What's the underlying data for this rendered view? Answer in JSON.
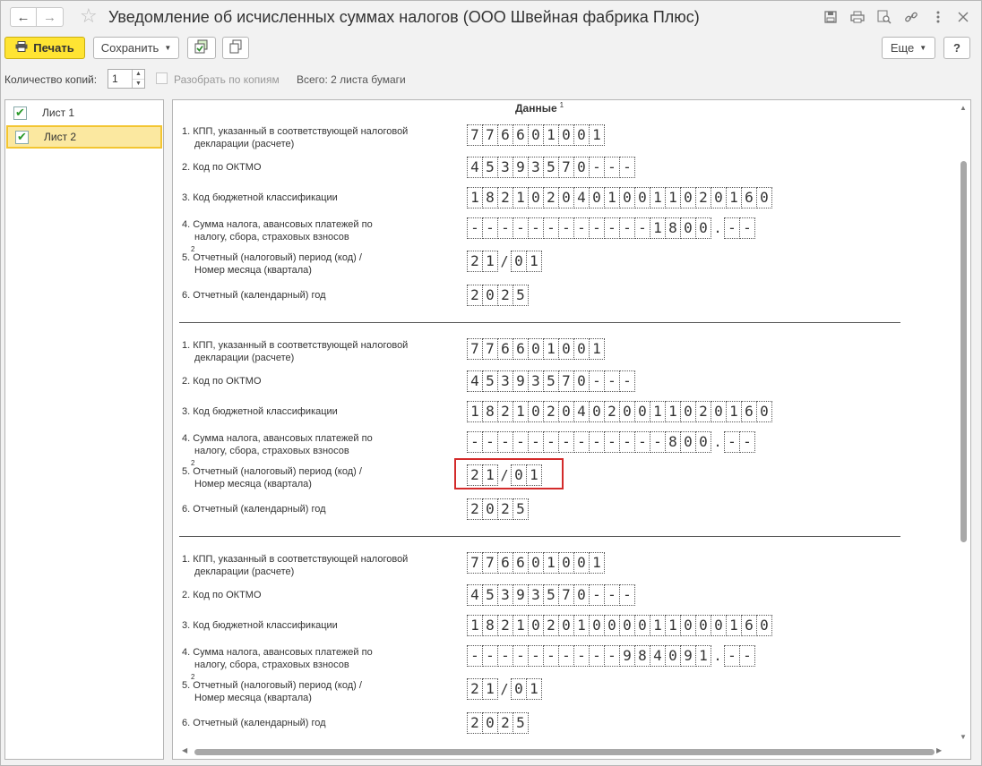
{
  "window": {
    "title": "Уведомление об исчисленных суммах налогов (ООО Швейная фабрика Плюс)",
    "back_icon": "←",
    "forward_icon": "→",
    "star_icon": "☆"
  },
  "toolbar": {
    "print_label": "Печать",
    "save_label": "Сохранить",
    "more_label": "Еще",
    "help_label": "?"
  },
  "copies": {
    "label": "Количество копий:",
    "value": "1",
    "collate_label": "Разобрать по копиям",
    "total_label": "Всего: 2 листа бумаги"
  },
  "sheets": [
    {
      "label": "Лист 1",
      "checked": true
    },
    {
      "label": "Лист 2",
      "checked": true,
      "selected": true
    }
  ],
  "document": {
    "header": "Данные",
    "header_sup": "1",
    "labels": {
      "kpp_1": "1. КПП, указанный в соответствующей налоговой",
      "kpp_2": "декларации (расчете)",
      "oktmo": "2. Код по ОКТМО",
      "kbk": "3. Код бюджетной классификации",
      "sum_1": "4. Сумма налога, авансовых платежей по",
      "sum_2": "налогу, сбора, страховых взносов",
      "sum_sup": "2",
      "period_1": "5. Отчетный (налоговый) период (код) /",
      "period_2": "Номер месяца (квартала)",
      "year": "6. Отчетный (календарный) год"
    },
    "blocks": [
      {
        "kpp": [
          "7",
          "7",
          "6",
          "6",
          "0",
          "1",
          "0",
          "0",
          "1"
        ],
        "oktmo": [
          "4",
          "5",
          "3",
          "9",
          "3",
          "5",
          "7",
          "0",
          "-",
          "-",
          "-"
        ],
        "kbk": [
          "1",
          "8",
          "2",
          "1",
          "0",
          "2",
          "0",
          "4",
          "0",
          "1",
          "0",
          "0",
          "1",
          "1",
          "0",
          "2",
          "0",
          "1",
          "6",
          "0"
        ],
        "sum_int": [
          "-",
          "-",
          "-",
          "-",
          "-",
          "-",
          "-",
          "-",
          "-",
          "-",
          "-",
          "-",
          "1",
          "8",
          "0",
          "0"
        ],
        "sum_frac": [
          "-",
          "-"
        ],
        "period_code": [
          "2",
          "1"
        ],
        "period_month": [
          "0",
          "1"
        ],
        "year": [
          "2",
          "0",
          "2",
          "5"
        ]
      },
      {
        "kpp": [
          "7",
          "7",
          "6",
          "6",
          "0",
          "1",
          "0",
          "0",
          "1"
        ],
        "oktmo": [
          "4",
          "5",
          "3",
          "9",
          "3",
          "5",
          "7",
          "0",
          "-",
          "-",
          "-"
        ],
        "kbk": [
          "1",
          "8",
          "2",
          "1",
          "0",
          "2",
          "0",
          "4",
          "0",
          "2",
          "0",
          "0",
          "1",
          "1",
          "0",
          "2",
          "0",
          "1",
          "6",
          "0"
        ],
        "sum_int": [
          "-",
          "-",
          "-",
          "-",
          "-",
          "-",
          "-",
          "-",
          "-",
          "-",
          "-",
          "-",
          "-",
          "8",
          "0",
          "0"
        ],
        "sum_frac": [
          "-",
          "-"
        ],
        "period_code": [
          "2",
          "1"
        ],
        "period_month": [
          "0",
          "1"
        ],
        "year": [
          "2",
          "0",
          "2",
          "5"
        ]
      },
      {
        "kpp": [
          "7",
          "7",
          "6",
          "6",
          "0",
          "1",
          "0",
          "0",
          "1"
        ],
        "oktmo": [
          "4",
          "5",
          "3",
          "9",
          "3",
          "5",
          "7",
          "0",
          "-",
          "-",
          "-"
        ],
        "kbk": [
          "1",
          "8",
          "2",
          "1",
          "0",
          "2",
          "0",
          "1",
          "0",
          "0",
          "0",
          "0",
          "1",
          "1",
          "0",
          "0",
          "0",
          "1",
          "6",
          "0"
        ],
        "sum_int": [
          "-",
          "-",
          "-",
          "-",
          "-",
          "-",
          "-",
          "-",
          "-",
          "-",
          "9",
          "8",
          "4",
          "0",
          "9",
          "1"
        ],
        "sum_frac": [
          "-",
          "-"
        ],
        "period_code": [
          "2",
          "1"
        ],
        "period_month": [
          "0",
          "1"
        ],
        "year": [
          "2",
          "0",
          "2",
          "5"
        ]
      }
    ],
    "separators": {
      "slash": "/",
      "dot": "."
    }
  }
}
